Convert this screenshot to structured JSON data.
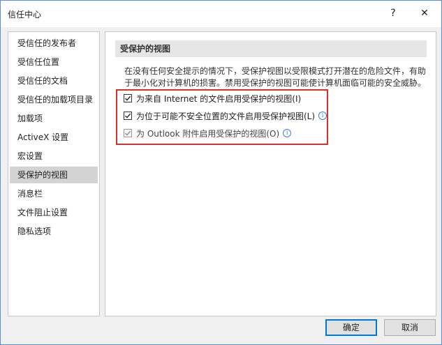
{
  "window": {
    "title": "信任中心",
    "help_glyph": "?",
    "close_glyph": "✕"
  },
  "sidebar": {
    "items": [
      {
        "label": "受信任的发布者"
      },
      {
        "label": "受信任位置"
      },
      {
        "label": "受信任的文档"
      },
      {
        "label": "受信任的加载项目录"
      },
      {
        "label": "加载项"
      },
      {
        "label": "ActiveX 设置"
      },
      {
        "label": "宏设置"
      },
      {
        "label": "受保护的视图",
        "selected": true
      },
      {
        "label": "消息栏"
      },
      {
        "label": "文件阻止设置"
      },
      {
        "label": "隐私选项"
      }
    ]
  },
  "content": {
    "header": "受保护的视图",
    "description_line1": "在没有任何安全提示的情况下，受保护视图以受限模式打开潜在的危险文件，有助",
    "description_line2": "于最小化对计算机的损害。禁用受保护的视图可能使计算机面临可能的安全威胁。",
    "options": [
      {
        "label": "为来自 Internet 的文件启用受保护的视图(I)",
        "checked": true,
        "disabled": false,
        "info": false
      },
      {
        "label": "为位于可能不安全位置的文件启用受保护视图(L)",
        "checked": true,
        "disabled": false,
        "info": true
      },
      {
        "label": "为 Outlook 附件启用受保护的视图(O)",
        "checked": true,
        "disabled": true,
        "info": true
      }
    ],
    "info_glyph": "i"
  },
  "footer": {
    "ok_label": "确定",
    "cancel_label": "取消"
  },
  "colors": {
    "highlight_border": "#d9312a",
    "selected_item": "#d3d3d3",
    "info_icon": "#3b7fd6"
  }
}
